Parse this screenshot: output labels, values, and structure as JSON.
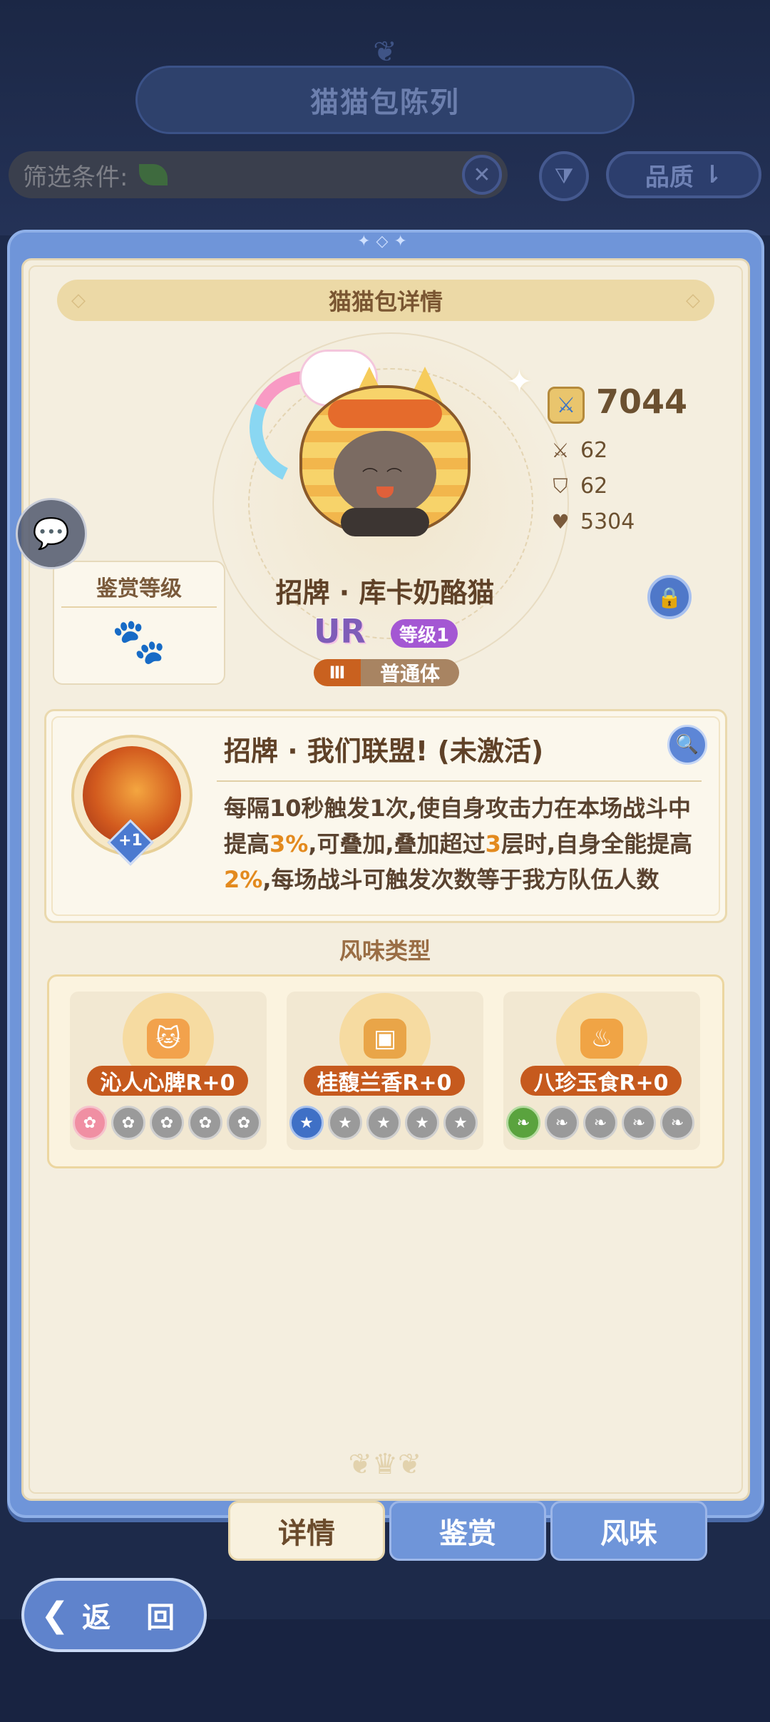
{
  "background": {
    "title": "猫猫包陈列",
    "filter_label": "筛选条件:",
    "quality_label": "品质"
  },
  "detail": {
    "header": "猫猫包详情",
    "power": "7044",
    "stats": {
      "attack": "62",
      "defense": "62",
      "hp": "5304"
    },
    "appraise_title": "鉴赏等级",
    "cat_name": "招牌 · 库卡奶酪猫",
    "rarity": "UR",
    "level": "等级1",
    "rank": "Ⅲ",
    "body_type": "普通体"
  },
  "skill": {
    "name": "招牌 · 我们联盟! (未激活)",
    "plus_label": "+1",
    "desc_part1": "每隔10秒触发1次,使自身攻击力在本场战斗中提高",
    "desc_hl1": "3%",
    "desc_part2": ",可叠加,叠加超过",
    "desc_hl2": "3",
    "desc_part3": "层时,自身全能提高",
    "desc_hl3": "2%",
    "desc_part4": ",每场战斗可触发次数等于我方队伍人数"
  },
  "flavor": {
    "title": "风味类型",
    "items": [
      {
        "label": "沁人心脾R+0",
        "color": "#f08fa3"
      },
      {
        "label": "桂馥兰香R+0",
        "color": "#3f70c6"
      },
      {
        "label": "八珍玉食R+0",
        "color": "#5aa33e"
      }
    ]
  },
  "tabs": {
    "detail": "详情",
    "appraise": "鉴赏",
    "flavor": "风味"
  },
  "back_label": "返 回"
}
